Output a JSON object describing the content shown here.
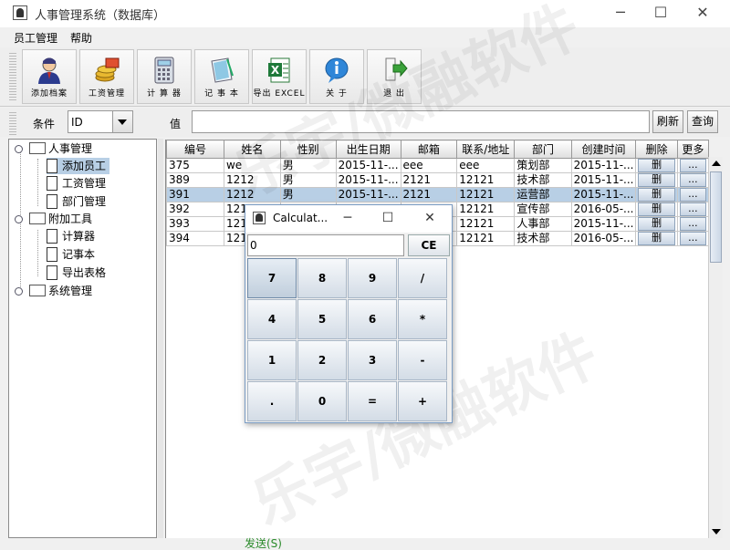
{
  "window": {
    "title": "人事管理系统（数据库）"
  },
  "menu": [
    "员工管理",
    "帮助"
  ],
  "toolbar": [
    {
      "label": "添加档案",
      "icon": "user-icon"
    },
    {
      "label": "工资管理",
      "icon": "coins-icon"
    },
    {
      "label": "计 算 器",
      "icon": "calculator-icon"
    },
    {
      "label": "记 事 本",
      "icon": "notebook-icon"
    },
    {
      "label": "导出 EXCEL",
      "icon": "excel-icon"
    },
    {
      "label": "关  于",
      "icon": "info-icon"
    },
    {
      "label": "退  出",
      "icon": "exit-icon"
    }
  ],
  "filter": {
    "condition_label": "条件",
    "condition_value": "ID",
    "value_label": "值",
    "refresh_label": "刷新",
    "query_label": "查询"
  },
  "tree": {
    "nodes": [
      "人事管理",
      "添加员工",
      "工资管理",
      "部门管理",
      "附加工具",
      "计算器",
      "记事本",
      "导出表格",
      "系统管理"
    ]
  },
  "table": {
    "headers": [
      "编号",
      "姓名",
      "性别",
      "出生日期",
      "邮箱",
      "联系/地址",
      "部门",
      "创建时间",
      "删除",
      "更多"
    ],
    "delete_label": "删",
    "more_label": "...",
    "rows": [
      [
        "375",
        "we",
        "男",
        "2015-11-...",
        "eee",
        "eee",
        "策划部",
        "2015-11-..."
      ],
      [
        "389",
        "1212",
        "男",
        "2015-11-...",
        "2121",
        "12121",
        "技术部",
        "2015-11-..."
      ],
      [
        "391",
        "1212",
        "男",
        "2015-11-...",
        "2121",
        "12121",
        "运营部",
        "2015-11-..."
      ],
      [
        "392",
        "121",
        "",
        "",
        "",
        "12121",
        "宣传部",
        "2016-05-..."
      ],
      [
        "393",
        "121",
        "",
        "",
        "",
        "12121",
        "人事部",
        "2015-11-..."
      ],
      [
        "394",
        "121",
        "",
        "",
        "",
        "12121",
        "技术部",
        "2016-05-..."
      ]
    ]
  },
  "calculator": {
    "title": "Calculat...",
    "display": "0",
    "ce_label": "CE",
    "keys": [
      [
        "7",
        "8",
        "9",
        "/"
      ],
      [
        "4",
        "5",
        "6",
        "*"
      ],
      [
        "1",
        "2",
        "3",
        "-"
      ],
      [
        ".",
        "0",
        "=",
        "+"
      ]
    ]
  },
  "background": {
    "watermark_text": "乐宇/微融软件",
    "send_text": "发送(S)"
  }
}
